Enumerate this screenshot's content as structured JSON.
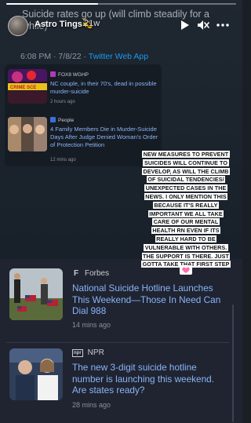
{
  "story": {
    "progress_fraction": 0.4,
    "username": "Astro Tings💫",
    "time_ago": "21w",
    "overlay_title": "Suicide rates go up (will climb steadily for a while)",
    "controls": [
      "play-icon",
      "mute-icon",
      "more-icon"
    ]
  },
  "tweet": {
    "timestamp": "6:08 PM · 7/8/22 · ",
    "source": "Twitter Web App"
  },
  "top_news": [
    {
      "source": "FOX8 WGHP",
      "headline": "NC couple, in their 70's, dead in possible murder-suicide",
      "age": "2 hours ago"
    },
    {
      "source": "People",
      "headline": "4 Family Members Die in Murder-Suicide Days After Judge Denied Woman's Order of Protection Petition",
      "age": "12 mins ago"
    }
  ],
  "sticker_lines": [
    "NEW MEASURES TO PREVENT",
    "SUICIDES WILL CONTINUE TO",
    "DEVELOP, AS WILL THE CLIMB",
    "OF SUICIDAL TENDENCIES/",
    "UNEXPECTED CASES IN THE",
    "NEWS. I ONLY MENTION THIS",
    "BECAUSE IT'S REALLY",
    "IMPORTANT WE ALL TAKE",
    "CARE OF OUR MENTAL",
    "HEALTH RN EVEN IF ITS",
    "REALLY HARD TO BE",
    "VULNERABLE WITH OTHERS.",
    "THE SUPPORT IS THERE. JUST",
    "GOTTA TAKE THAT FIRST STEP"
  ],
  "bottom_news": [
    {
      "logo": "F",
      "source": "Forbes",
      "headline": "National Suicide Hotline Launches This Weekend—Those In Need Can Dial 988",
      "age": "14 mins ago"
    },
    {
      "logo": "npr",
      "source": "NPR",
      "headline": "The new 3-digit suicide hotline number is launching this weekend. Are states ready?",
      "age": "28 mins ago"
    }
  ],
  "colors": {
    "link": "#8ab4f8",
    "twitter_blue": "#1d9bf0",
    "heart": "#ff6fae"
  }
}
